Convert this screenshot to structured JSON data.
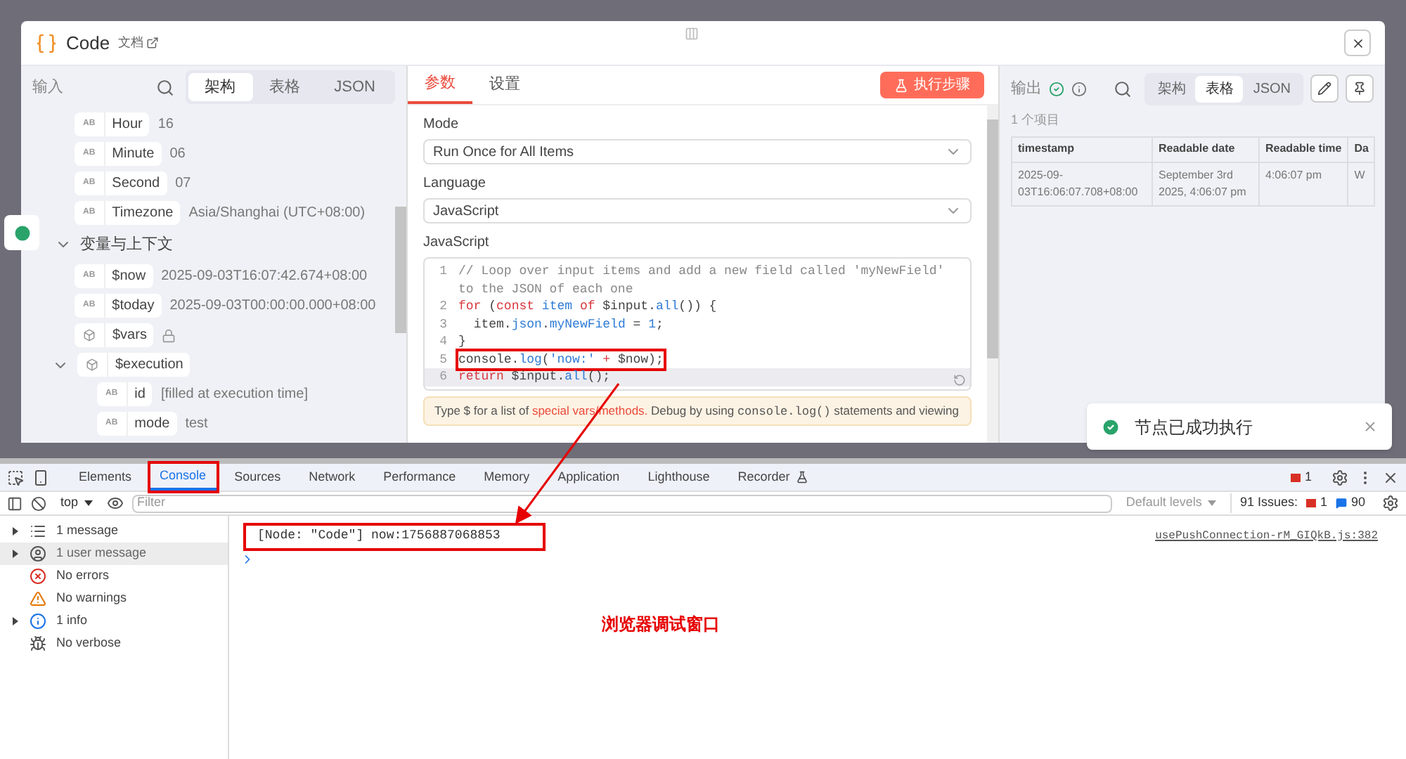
{
  "modal": {
    "title": "Code",
    "docs_link": "文档"
  },
  "input_panel": {
    "title": "输入",
    "view_tabs": [
      {
        "label": "架构",
        "selected": true
      },
      {
        "label": "表格",
        "selected": false
      },
      {
        "label": "JSON",
        "selected": false
      }
    ],
    "fields": [
      {
        "name": "Hour",
        "kind": "string",
        "badge": "AB",
        "value": "16"
      },
      {
        "name": "Minute",
        "kind": "string",
        "badge": "AB",
        "value": "06"
      },
      {
        "name": "Second",
        "kind": "string",
        "badge": "AB",
        "value": "07"
      },
      {
        "name": "Timezone",
        "kind": "string",
        "badge": "AB",
        "value": "Asia/Shanghai (UTC+08:00)"
      }
    ],
    "sections": [
      {
        "label": "变量与上下文",
        "expanded": true,
        "children": [
          {
            "name": "$now",
            "kind": "string",
            "badge": "AB",
            "value": "2025-09-03T16:07:42.674+08:00"
          },
          {
            "name": "$today",
            "kind": "string",
            "badge": "AB",
            "value": "2025-09-03T00:00:00.000+08:00"
          },
          {
            "name": "$vars",
            "kind": "object",
            "locked": true
          },
          {
            "name": "$execution",
            "kind": "object",
            "expanded": true,
            "children": [
              {
                "name": "id",
                "kind": "string",
                "badge": "AB",
                "value": "[filled at execution time]"
              },
              {
                "name": "mode",
                "kind": "string",
                "badge": "AB",
                "value": "test"
              }
            ]
          }
        ]
      }
    ]
  },
  "params_panel": {
    "tabs": [
      {
        "label": "参数",
        "selected": true
      },
      {
        "label": "设置",
        "selected": false
      }
    ],
    "run_button": "执行步骤",
    "selects": [
      {
        "label": "Mode",
        "value": "Run Once for All Items"
      },
      {
        "label": "Language",
        "value": "JavaScript"
      }
    ],
    "editor_label": "JavaScript",
    "code_lines": [
      {
        "number": "1",
        "active": false,
        "annotated": false,
        "tokens": [
          {
            "kind": "comment",
            "text": "// Loop over input items and add a new field called 'myNewField' to the JSON of each one"
          }
        ]
      },
      {
        "number": "2",
        "active": false,
        "annotated": false,
        "tokens": [
          {
            "kind": "keyword",
            "text": "for"
          },
          {
            "kind": "plain",
            "text": " ("
          },
          {
            "kind": "keyword",
            "text": "const"
          },
          {
            "kind": "method",
            "text": " item"
          },
          {
            "kind": "keyword",
            "text": " of"
          },
          {
            "kind": "plain",
            "text": " $input."
          },
          {
            "kind": "method",
            "text": "all"
          },
          {
            "kind": "plain",
            "text": "()) {"
          }
        ]
      },
      {
        "number": "3",
        "active": false,
        "annotated": false,
        "tokens": [
          {
            "kind": "plain",
            "text": "  item."
          },
          {
            "kind": "method",
            "text": "json"
          },
          {
            "kind": "plain",
            "text": "."
          },
          {
            "kind": "method",
            "text": "myNewField"
          },
          {
            "kind": "plain",
            "text": " = "
          },
          {
            "kind": "number",
            "text": "1"
          },
          {
            "kind": "plain",
            "text": ";"
          }
        ]
      },
      {
        "number": "4",
        "active": false,
        "annotated": false,
        "tokens": [
          {
            "kind": "plain",
            "text": "}"
          }
        ]
      },
      {
        "number": "5",
        "active": false,
        "annotated": true,
        "tokens": [
          {
            "kind": "plain",
            "text": "console."
          },
          {
            "kind": "method",
            "text": "log"
          },
          {
            "kind": "plain",
            "text": "("
          },
          {
            "kind": "string",
            "text": "'now:'"
          },
          {
            "kind": "keyword",
            "text": " +"
          },
          {
            "kind": "plain",
            "text": " $now);"
          }
        ]
      },
      {
        "number": "6",
        "active": true,
        "annotated": false,
        "tokens": [
          {
            "kind": "keyword",
            "text": "return"
          },
          {
            "kind": "plain",
            "text": " $input."
          },
          {
            "kind": "method",
            "text": "all"
          },
          {
            "kind": "plain",
            "text": "();"
          }
        ]
      }
    ],
    "hint": [
      {
        "kind": "text",
        "text": "Type $ for a list of "
      },
      {
        "kind": "link",
        "text": "special vars/methods."
      },
      {
        "kind": "text",
        "text": " Debug by using "
      },
      {
        "kind": "code",
        "text": "console.log()"
      },
      {
        "kind": "text",
        "text": " statements and viewing"
      }
    ]
  },
  "output_panel": {
    "title": "输出",
    "view_tabs": [
      {
        "label": "架构",
        "selected": false
      },
      {
        "label": "表格",
        "selected": true
      },
      {
        "label": "JSON",
        "selected": false
      }
    ],
    "item_count": "1 个项目",
    "table": {
      "columns": [
        "timestamp",
        "Readable date",
        "Readable time",
        "Da"
      ],
      "rows": [
        [
          "2025-09-03T16:06:07.708+08:00",
          "September 3rd 2025, 4:06:07 pm",
          "4:06:07 pm",
          "W"
        ]
      ]
    }
  },
  "toast": {
    "message": "节点已成功执行"
  },
  "devtools": {
    "tabs": [
      {
        "label": "Elements",
        "selected": false,
        "annotated": false
      },
      {
        "label": "Console",
        "selected": true,
        "annotated": true
      },
      {
        "label": "Sources",
        "selected": false,
        "annotated": false
      },
      {
        "label": "Network",
        "selected": false,
        "annotated": false
      },
      {
        "label": "Performance",
        "selected": false,
        "annotated": false
      },
      {
        "label": "Memory",
        "selected": false,
        "annotated": false
      },
      {
        "label": "Application",
        "selected": false,
        "annotated": false
      },
      {
        "label": "Lighthouse",
        "selected": false,
        "annotated": false
      },
      {
        "label": "Recorder",
        "selected": false,
        "annotated": false
      }
    ],
    "error_count": "1",
    "context": "top",
    "filter_placeholder": "Filter",
    "levels": "Default levels",
    "issues_label": "91 Issues:",
    "issues_errors": "1",
    "issues_info": "90",
    "sidebar": [
      {
        "kind": "messages",
        "label": "1 message",
        "expandable": true,
        "selected": false
      },
      {
        "kind": "user",
        "label": "1 user message",
        "expandable": true,
        "selected": true
      },
      {
        "kind": "errors",
        "label": "No errors",
        "expandable": false,
        "selected": false
      },
      {
        "kind": "warnings",
        "label": "No warnings",
        "expandable": false,
        "selected": false
      },
      {
        "kind": "info",
        "label": "1 info",
        "expandable": true,
        "selected": false
      },
      {
        "kind": "verbose",
        "label": "No verbose",
        "expandable": false,
        "selected": false
      }
    ],
    "messages": [
      {
        "text": "[Node: \"Code\"] now:1756887068853",
        "source": "usePushConnection-rM_GIQkB.js:382",
        "annotated": true
      }
    ]
  },
  "annotation": {
    "label": "浏览器调试窗口"
  }
}
